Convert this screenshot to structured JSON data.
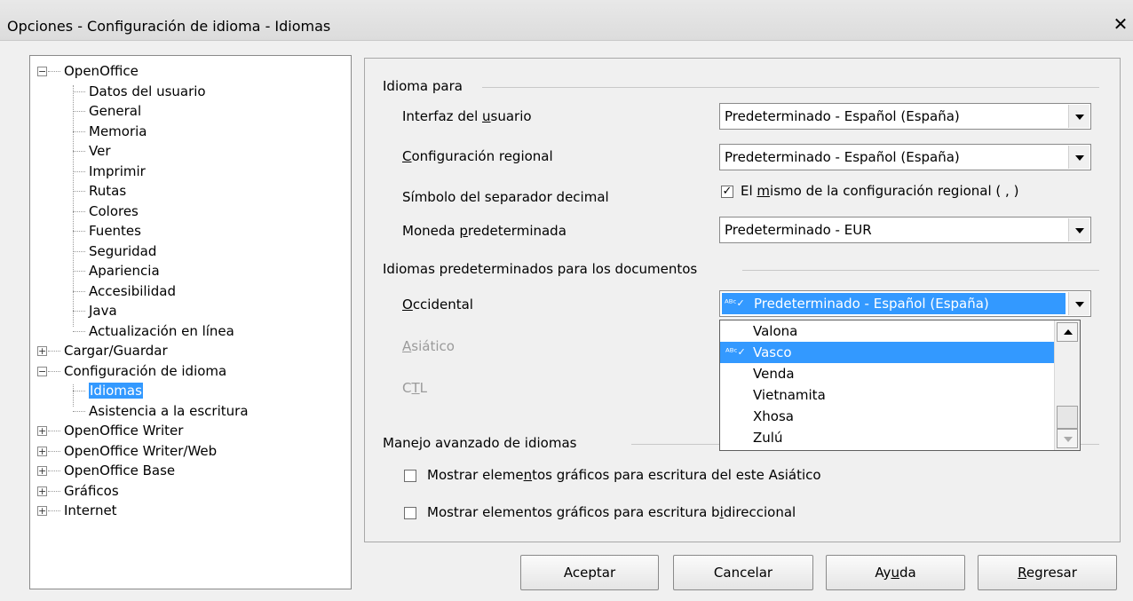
{
  "window": {
    "title": "Opciones - Configuración de idioma - Idiomas",
    "close_symbol": "✕"
  },
  "tree": {
    "nodes": [
      {
        "label": "OpenOffice",
        "expander": "minus"
      },
      {
        "label": "Datos del usuario"
      },
      {
        "label": "General"
      },
      {
        "label": "Memoria"
      },
      {
        "label": "Ver"
      },
      {
        "label": "Imprimir"
      },
      {
        "label": "Rutas"
      },
      {
        "label": "Colores"
      },
      {
        "label": "Fuentes"
      },
      {
        "label": "Seguridad"
      },
      {
        "label": "Apariencia"
      },
      {
        "label": "Accesibilidad"
      },
      {
        "label": "Java"
      },
      {
        "label": "Actualización en línea"
      },
      {
        "label": "Cargar/Guardar",
        "expander": "plus"
      },
      {
        "label": "Configuración de idioma",
        "expander": "minus"
      },
      {
        "label": "Idiomas",
        "selected": true
      },
      {
        "label": "Asistencia a la escritura"
      },
      {
        "label": "OpenOffice Writer",
        "expander": "plus"
      },
      {
        "label": "OpenOffice Writer/Web",
        "expander": "plus"
      },
      {
        "label": "OpenOffice Base",
        "expander": "plus"
      },
      {
        "label": "Gráficos",
        "expander": "plus"
      },
      {
        "label": "Internet",
        "expander": "plus"
      }
    ]
  },
  "language_for": {
    "group_title": "Idioma para",
    "ui_label": [
      "Interfaz del ",
      "u",
      "suario"
    ],
    "ui_value": "Predeterminado - Español (España)",
    "locale_label": [
      "",
      "C",
      "onfiguración regional"
    ],
    "locale_value": "Predeterminado - Español (España)",
    "decimal_label": "Símbolo del separador decimal",
    "decimal_checkbox": [
      "El ",
      "m",
      "ismo de la configuración regional ( , )"
    ],
    "decimal_checked": true,
    "currency_label": [
      "Moneda ",
      "p",
      "redeterminada"
    ],
    "currency_value": "Predeterminado - EUR"
  },
  "doc_languages": {
    "group_title": "Idiomas predeterminados para los documentos",
    "western_label": [
      "",
      "O",
      "ccidental"
    ],
    "western_value": "Predeterminado - Español (España)",
    "asian_label": [
      "",
      "A",
      "siático"
    ],
    "ctl_label": [
      "C",
      "T",
      "L"
    ],
    "spell_icon": "ᴬᴮᶜ✓",
    "dropdown_items": [
      {
        "label": "Valona"
      },
      {
        "label": "Vasco",
        "selected": true,
        "spell": true
      },
      {
        "label": "Venda"
      },
      {
        "label": "Vietnamita"
      },
      {
        "label": "Xhosa"
      },
      {
        "label": "Zulú"
      }
    ]
  },
  "advanced": {
    "group_title": "Manejo avanzado de idiomas",
    "asian_check": [
      "Mostrar eleme",
      "n",
      "tos gráficos para escritura del este Asiático"
    ],
    "asian_checked": false,
    "bidi_check": [
      "Mostrar elementos gráficos para escritura b",
      "i",
      "direccional"
    ],
    "bidi_checked": false
  },
  "buttons": {
    "ok": "Aceptar",
    "cancel": "Cancelar",
    "help": [
      "Ay",
      "u",
      "da"
    ],
    "reset": [
      "",
      "R",
      "egresar"
    ]
  },
  "colors": {
    "selection": "#3399ff",
    "background": "#f0f0f0"
  }
}
